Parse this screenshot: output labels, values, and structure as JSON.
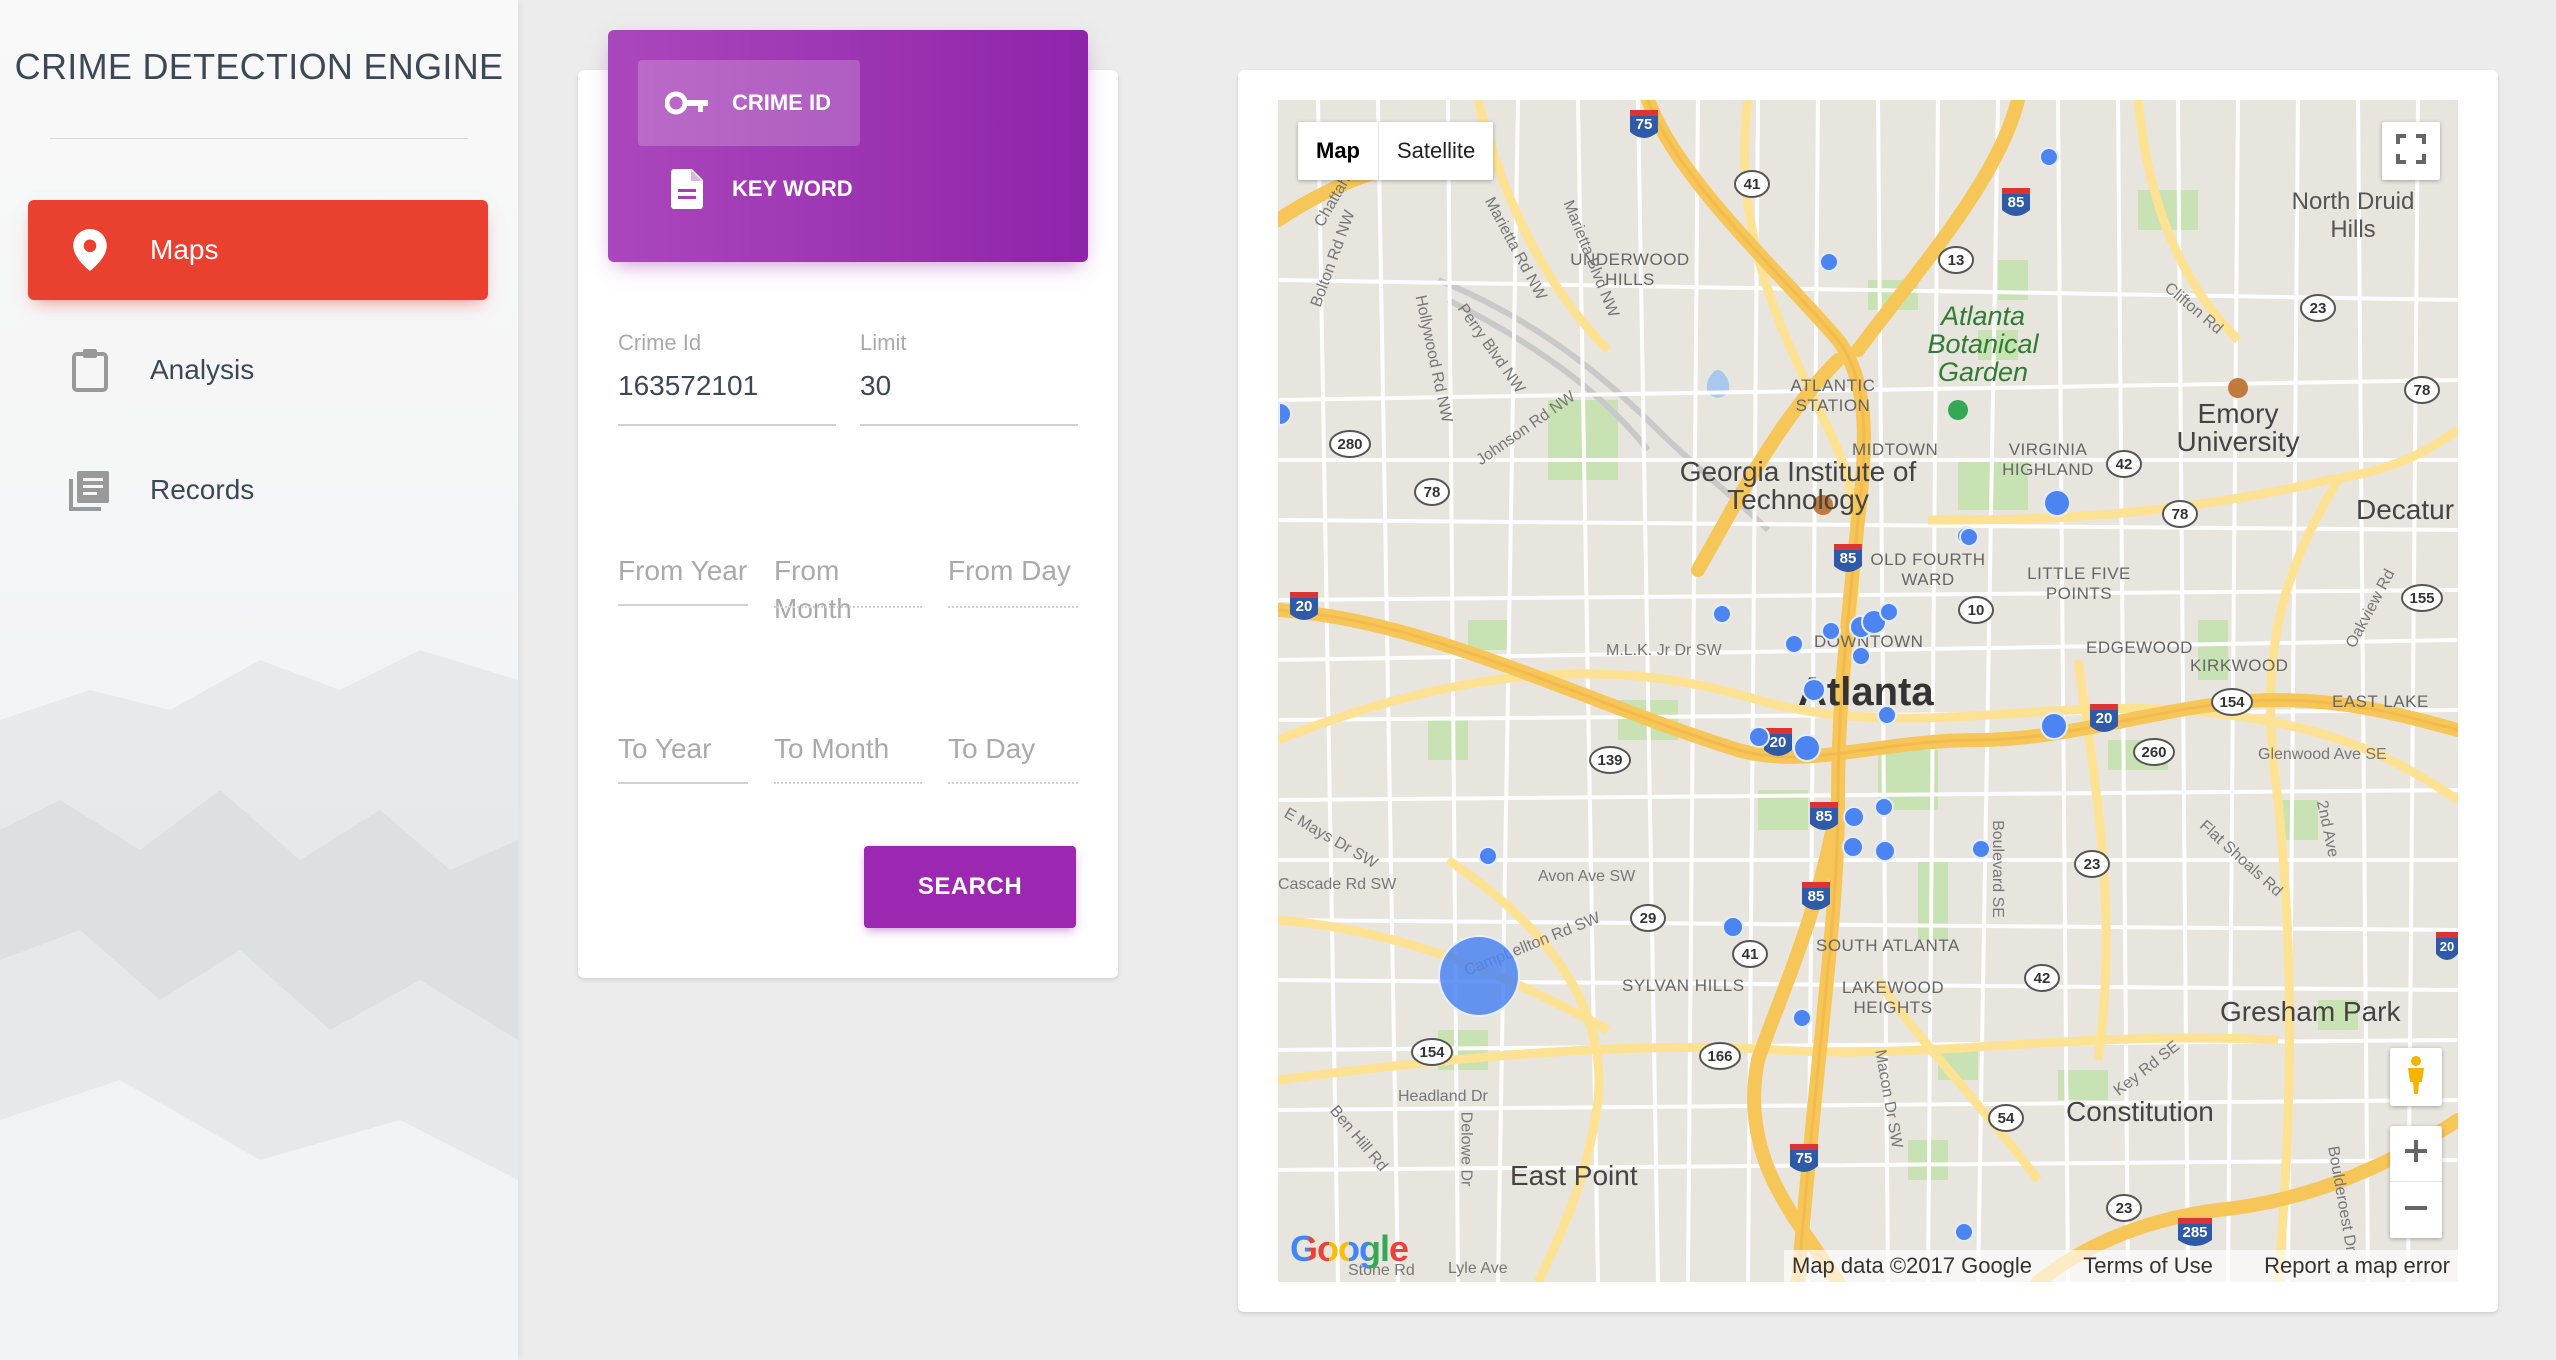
{
  "app": {
    "title": "CRIME DETECTION ENGINE"
  },
  "sidebar": {
    "items": [
      {
        "label": "Maps",
        "icon": "location-pin-icon",
        "active": true
      },
      {
        "label": "Analysis",
        "icon": "clipboard-icon",
        "active": false
      },
      {
        "label": "Records",
        "icon": "records-icon",
        "active": false
      }
    ]
  },
  "search": {
    "tabs": [
      {
        "label": "CRIME ID",
        "icon": "key-icon",
        "active": true
      },
      {
        "label": "KEY WORD",
        "icon": "document-icon",
        "active": false
      }
    ],
    "crime_id": {
      "label": "Crime Id",
      "value": "163572101"
    },
    "limit": {
      "label": "Limit",
      "value": "30"
    },
    "from_year": {
      "placeholder": "From Year"
    },
    "from_month": {
      "placeholder": "From Month"
    },
    "from_day": {
      "placeholder": "From Day"
    },
    "to_year": {
      "placeholder": "To Year"
    },
    "to_month": {
      "placeholder": "To Month"
    },
    "to_day": {
      "placeholder": "To Day"
    },
    "button_label": "SEARCH"
  },
  "map": {
    "map_types": [
      "Map",
      "Satellite"
    ],
    "selected_type": "Map",
    "city": "Atlanta",
    "places": [
      "Georgia Institute of Technology",
      "Emory University",
      "North Druid Hills",
      "Decatur",
      "East Point",
      "Gresham Park",
      "Constitution",
      "Atlanta Botanical Garden"
    ],
    "neighborhoods": [
      "UNDERWOOD HILLS",
      "ATLANTIC STATION",
      "MIDTOWN",
      "VIRGINIA HIGHLAND",
      "OLD FOURTH WARD",
      "LITTLE FIVE POINTS",
      "DOWNTOWN",
      "EDGEWOOD",
      "KIRKWOOD",
      "EAST LAKE",
      "SOUTH ATLANTA",
      "SYLVAN HILLS",
      "LAKEWOOD HEIGHTS"
    ],
    "streets": [
      "Marietta Rd NW",
      "Marietta Blvd NW",
      "Perry Blvd NW",
      "Hollywood Rd NW",
      "Bolton Rd NW",
      "Johnson Rd NW",
      "M.L.K. Jr Dr SW",
      "Avon Ave SW",
      "Campbellton Rd SW",
      "Cascade Rd SW",
      "Headland Dr",
      "Ben Hill Rd",
      "Delowe Dr",
      "Lyle Ave",
      "Clifton Rd",
      "Glenwood Ave SE",
      "Flat Shoals Rd",
      "Boulevard SE",
      "Key Rd SE",
      "Macon Dr SW",
      "Oakview Rd",
      "2nd Ave",
      "Boulderoest Dr",
      "Stone Rd",
      "Chattahoochee",
      "E Mays Dr SW"
    ],
    "route_shields": [
      "75",
      "41",
      "85",
      "13",
      "23",
      "78",
      "280",
      "20",
      "10",
      "42",
      "155",
      "154",
      "260",
      "139",
      "29",
      "166",
      "54",
      "285"
    ],
    "footer": {
      "data": "Map data ©2017 Google",
      "terms": "Terms of Use",
      "report": "Report a map error"
    },
    "logo": "Google",
    "marker_count": 28
  },
  "colors": {
    "primary": "#9c27b0",
    "active_nav": "#e9402f",
    "marker": "#4c84f2"
  }
}
